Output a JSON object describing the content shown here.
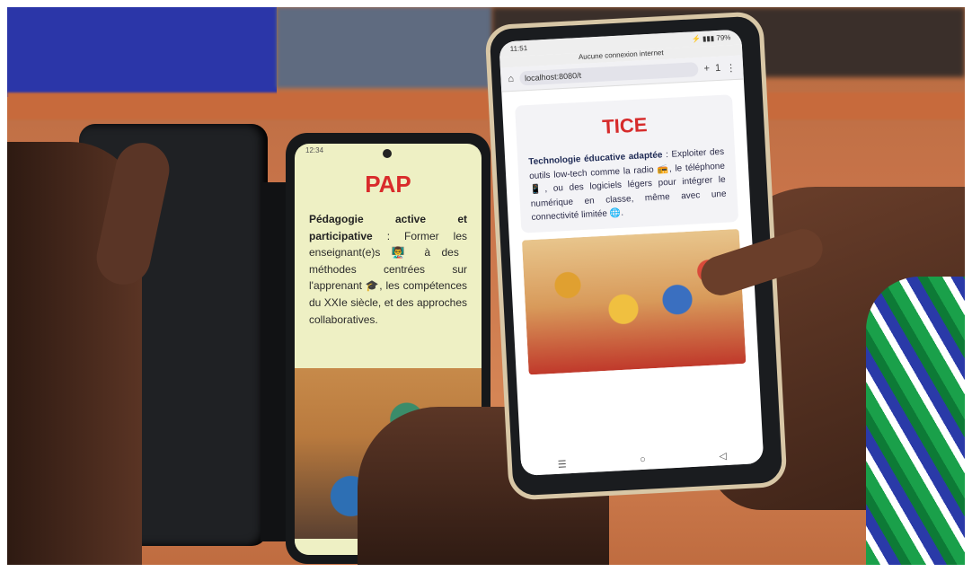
{
  "phone_left": {
    "status": "12:34",
    "title": "PAP",
    "term": "Pédagogie active et participative",
    "text": " : Former les enseignant(e)s 👨‍🏫 à des méthodes centrées sur l'apprenant 🎓, les compétences du XXIe siècle, et des approches collaboratives.",
    "nav_glyph": "☰"
  },
  "phone_right": {
    "status_time": "11:51",
    "status_icons": "⚡ ▮▮▮ 79%",
    "notice": "Aucune connexion internet",
    "url": "localhost:8080/t",
    "home_icon": "⌂",
    "add_icon": "+",
    "tabs_icon": "1",
    "menu_icon": "⋮",
    "title": "TICE",
    "term": "Technologie éducative adaptée",
    "text": " : Exploiter des outils low-tech comme la radio 📻, le téléphone 📱, ou des logiciels légers pour intégrer le numérique en classe, même avec une connectivité limitée 🌐.",
    "nav": [
      "☰",
      "○",
      "◁"
    ]
  }
}
